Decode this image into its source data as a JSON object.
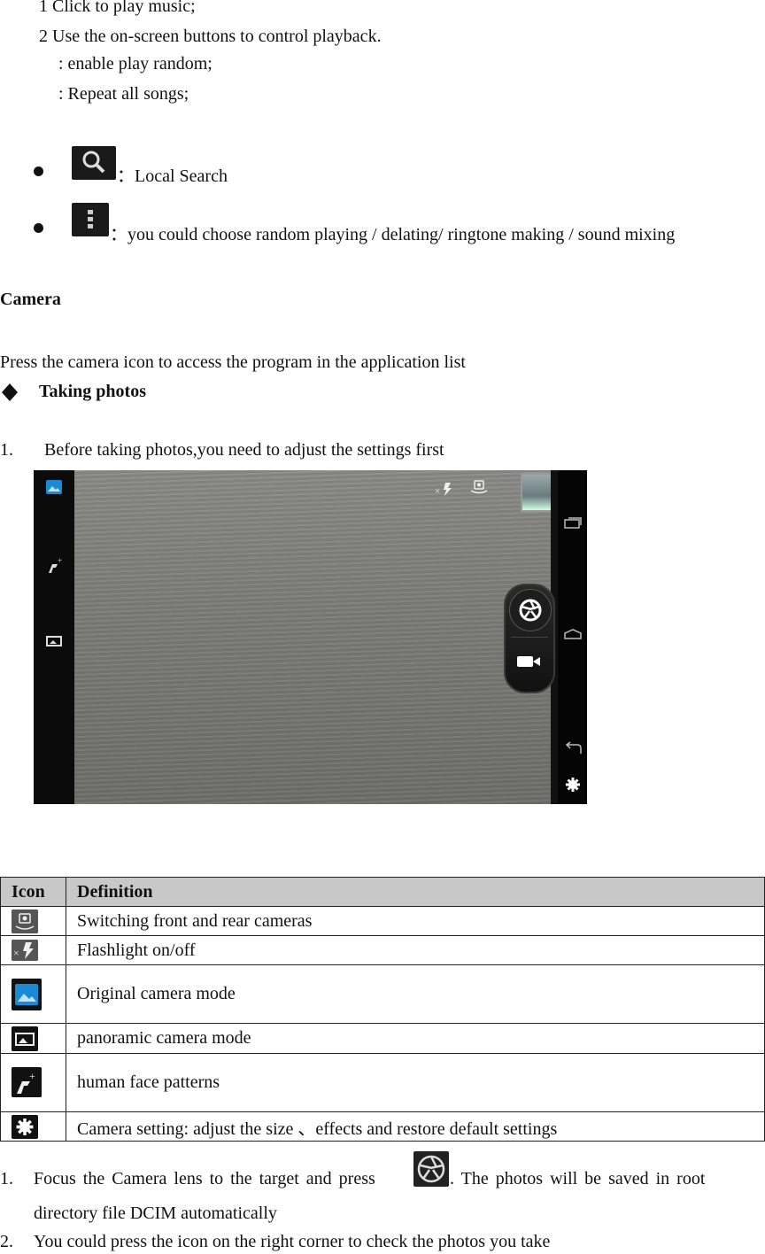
{
  "intro": {
    "line1": "1 Click to play music;",
    "line2": "2 Use the on-screen buttons to control playback.",
    "line3": ": enable play random;",
    "line4": ": Repeat all songs;"
  },
  "bullets": [
    {
      "icon": "search-icon",
      "text": "：Local Search"
    },
    {
      "icon": "menu-dots-icon",
      "text": "：you could choose random playing / delating/ ringtone making / sound mixing"
    }
  ],
  "camera_heading": "Camera",
  "camera_intro": "Press the camera icon to access the program in the application list",
  "taking_photos_heading": "Taking photos",
  "step1_number": "1.",
  "step1_text": "Before taking photos,you need to adjust the settings first",
  "table": {
    "headers": [
      "Icon",
      "Definition"
    ],
    "rows": [
      {
        "icon": "switch-camera-icon",
        "definition": "Switching front and rear cameras"
      },
      {
        "icon": "flash-off-icon",
        "definition": "Flashlight on/off"
      },
      {
        "icon": "picture-mode-icon",
        "definition": "Original camera mode"
      },
      {
        "icon": "panorama-icon",
        "definition": "panoramic camera mode"
      },
      {
        "icon": "face-effects-icon",
        "definition": "human face patterns"
      },
      {
        "icon": "settings-gear-icon",
        "definition": "Camera setting: adjust the size 、effects and    restore default settings"
      }
    ]
  },
  "after": {
    "item1_number": "1.",
    "item1_text_a": "Focus the Camera lens to the target and press",
    "item1_text_b": ". The photos will be saved in root",
    "item1_line2": "directory file DCIM automatically",
    "item2_number": "2.",
    "item2_text": "You could press the icon on the right corner to check the photos you take"
  }
}
